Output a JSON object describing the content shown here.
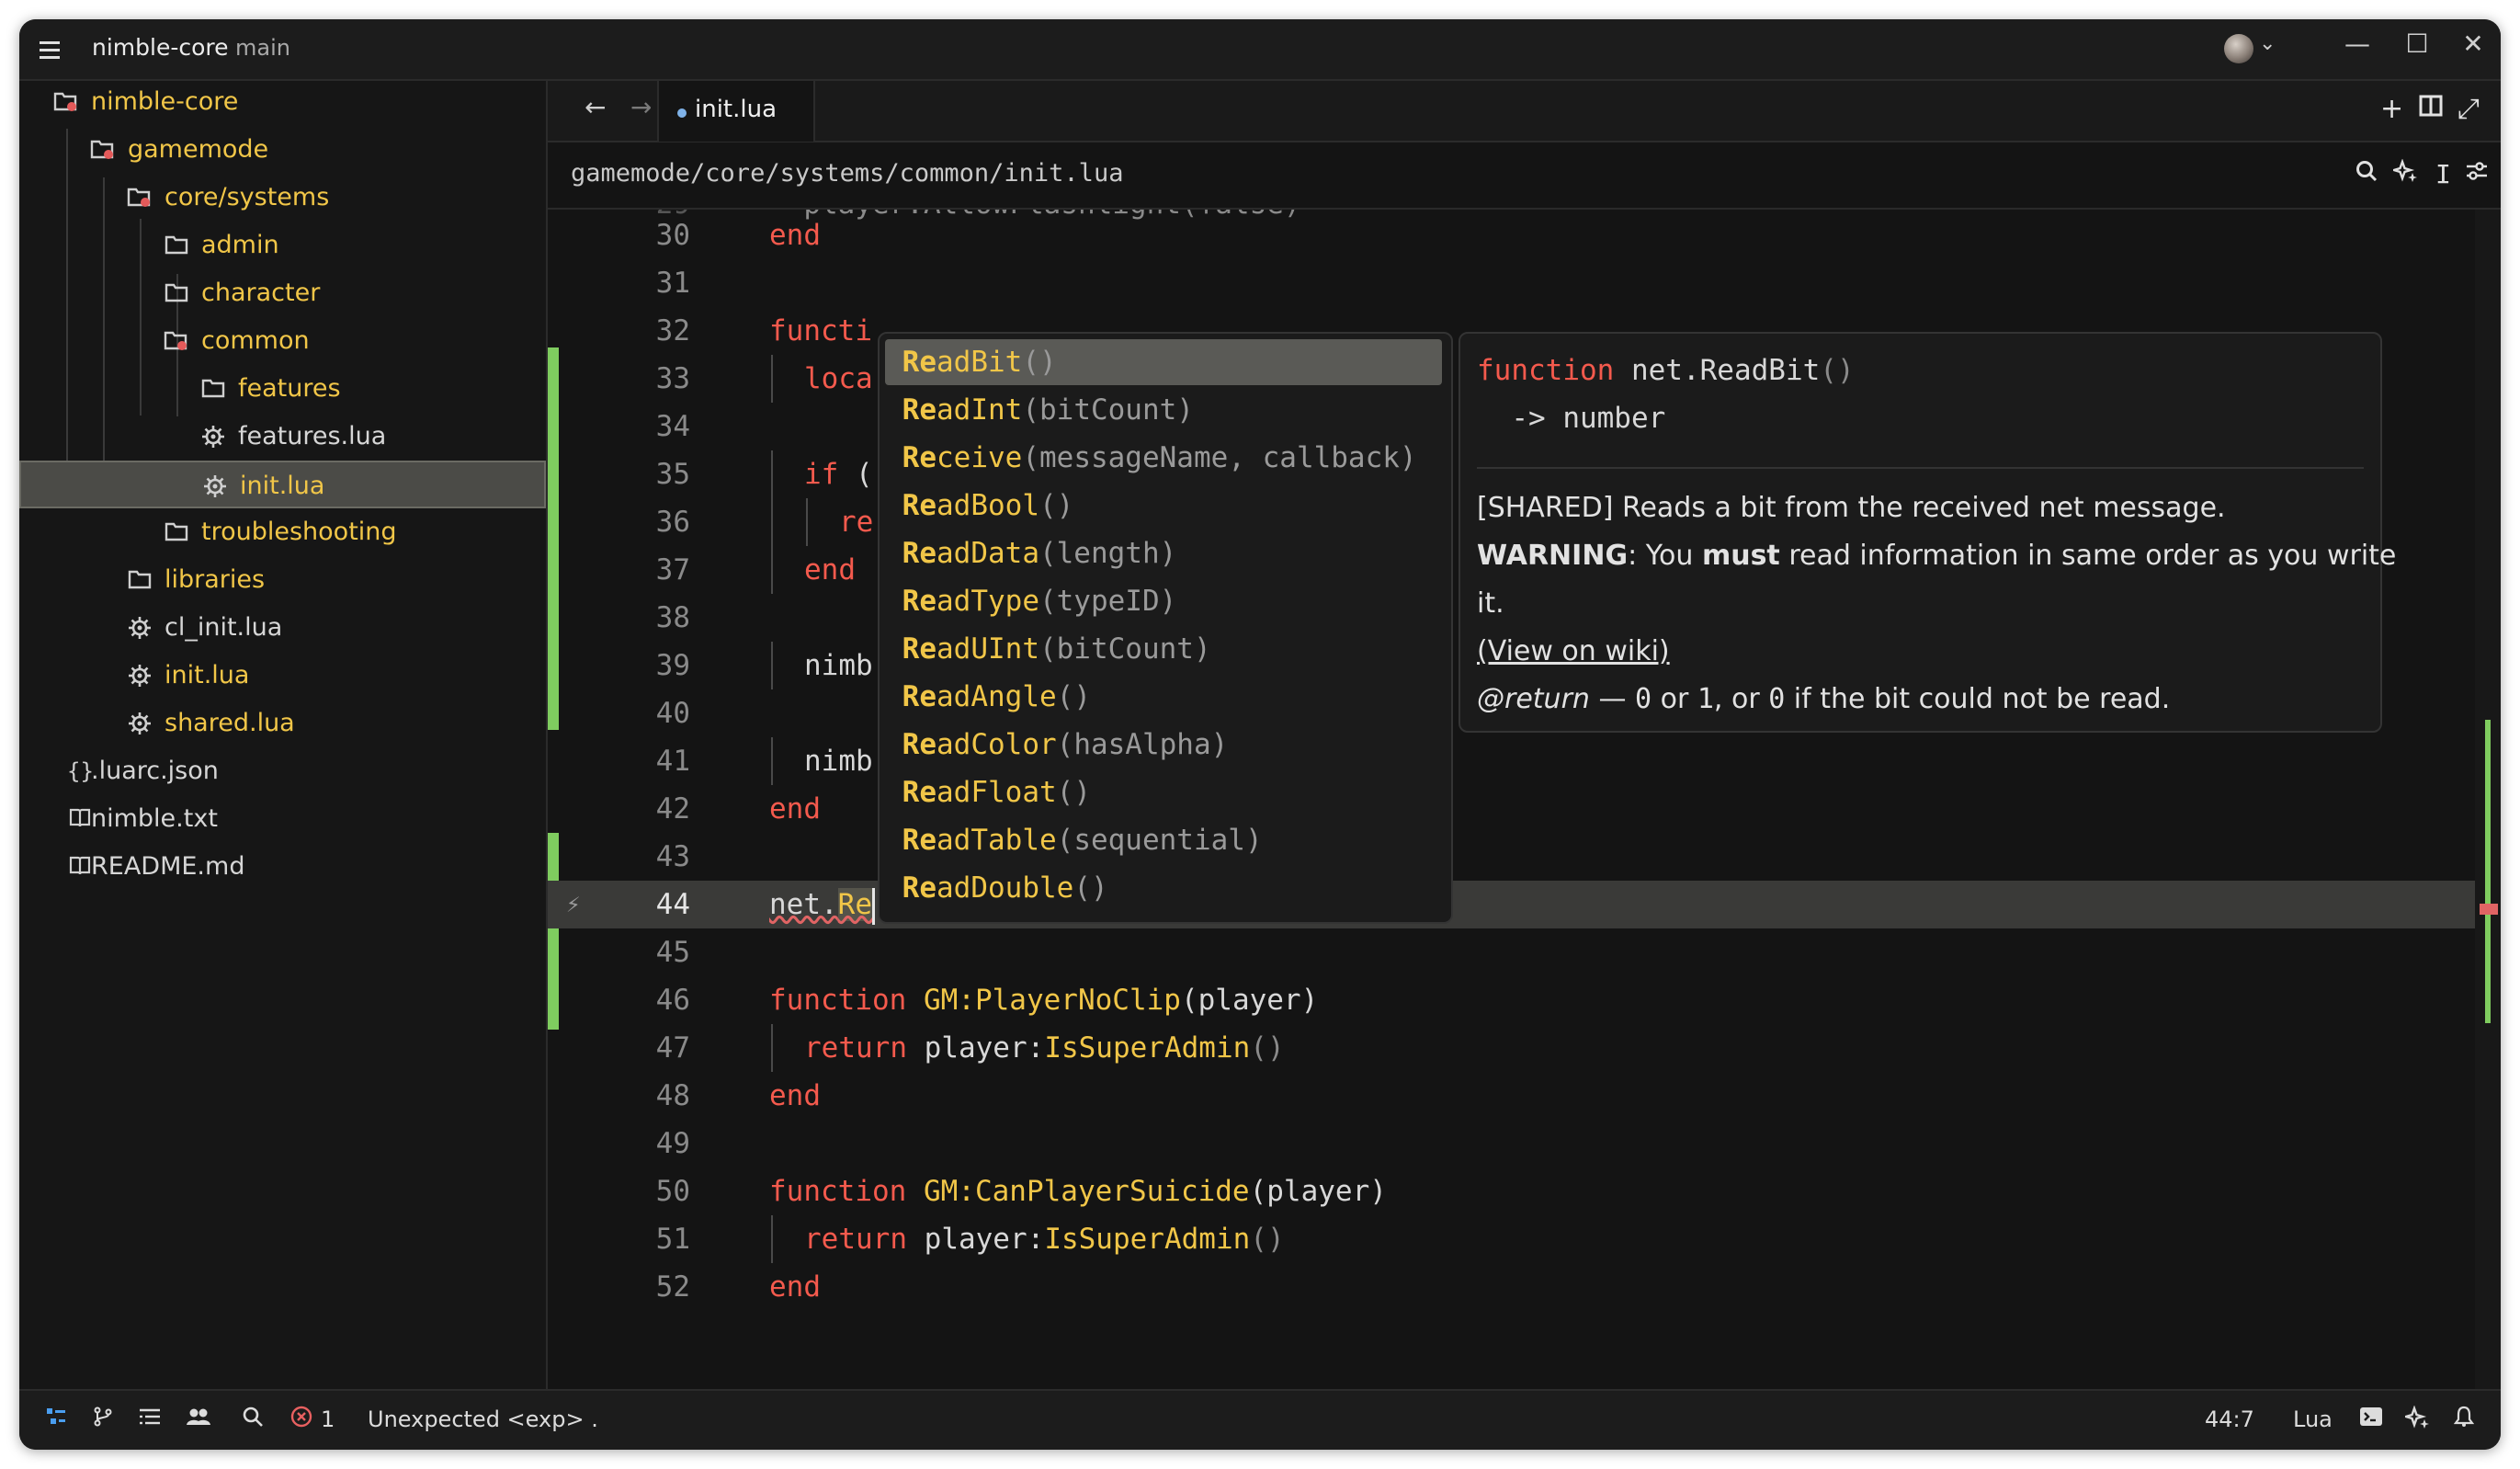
{
  "titlebar": {
    "project": "nimble-core",
    "branch": "main",
    "user_menu_chevron": "⌄"
  },
  "icons": {
    "menu": "hamburger-icon",
    "minimize": "—",
    "maximize": "☐",
    "close": "✕",
    "back": "←",
    "forward": "→",
    "new": "+",
    "split": "split-icon",
    "fullscreen": "⤢",
    "search": "search-icon",
    "assistant": "sparkle-icon",
    "cursor": "I",
    "settings": "sliders-icon",
    "lightning": "⚡"
  },
  "sidebar": {
    "items": [
      {
        "label": "nimble-core",
        "icon": "folder-git-icon",
        "color": "#f1c648"
      },
      {
        "label": "gamemode",
        "icon": "folder-git-icon",
        "color": "#f1c648"
      },
      {
        "label": "core/systems",
        "icon": "folder-git-icon",
        "color": "#f1c648"
      },
      {
        "label": "admin",
        "icon": "folder-icon",
        "color": "#f1c648"
      },
      {
        "label": "character",
        "icon": "folder-icon",
        "color": "#f1c648"
      },
      {
        "label": "common",
        "icon": "folder-git-icon",
        "color": "#f1c648"
      },
      {
        "label": "features",
        "icon": "folder-icon",
        "color": "#f1c648"
      },
      {
        "label": "features.lua",
        "icon": "lua-file-icon",
        "color": "#d6d6d6"
      },
      {
        "label": "init.lua",
        "icon": "lua-file-icon",
        "color": "#f1c648"
      },
      {
        "label": "troubleshooting",
        "icon": "folder-icon",
        "color": "#f1c648"
      },
      {
        "label": "libraries",
        "icon": "folder-icon",
        "color": "#f1c648"
      },
      {
        "label": "cl_init.lua",
        "icon": "lua-file-icon",
        "color": "#d6d6d6"
      },
      {
        "label": "init.lua",
        "icon": "lua-file-icon",
        "color": "#f1c648"
      },
      {
        "label": "shared.lua",
        "icon": "lua-file-icon",
        "color": "#f1c648"
      },
      {
        "label": ".luarc.json",
        "icon": "json-file-icon",
        "color": "#d6d6d6"
      },
      {
        "label": "nimble.txt",
        "icon": "book-icon",
        "color": "#d6d6d6"
      },
      {
        "label": "README.md",
        "icon": "book-icon",
        "color": "#d6d6d6"
      }
    ]
  },
  "tab": {
    "label": "init.lua"
  },
  "breadcrumb": {
    "path": "gamemode/core/systems/common/init.lua"
  },
  "editor": {
    "lines": [
      {
        "n": "30",
        "text": "end"
      },
      {
        "n": "31",
        "text": ""
      },
      {
        "n": "32",
        "text": "functi"
      },
      {
        "n": "33",
        "text": "loca"
      },
      {
        "n": "34",
        "text": ""
      },
      {
        "n": "35",
        "text": "if ("
      },
      {
        "n": "36",
        "text": "re"
      },
      {
        "n": "37",
        "text": "end"
      },
      {
        "n": "38",
        "text": ""
      },
      {
        "n": "39",
        "text": "nimb"
      },
      {
        "n": "40",
        "text": ""
      },
      {
        "n": "41",
        "text": "nimb"
      },
      {
        "n": "42",
        "text": "end"
      },
      {
        "n": "43",
        "text": ""
      },
      {
        "n": "44",
        "text": "net.Re"
      },
      {
        "n": "45",
        "text": ""
      },
      {
        "n": "46",
        "text": "function GM:PlayerNoClip(player)"
      },
      {
        "n": "47",
        "text": "return player:IsSuperAdmin()"
      },
      {
        "n": "48",
        "text": "end"
      },
      {
        "n": "49",
        "text": ""
      },
      {
        "n": "50",
        "text": "function GM:CanPlayerSuicide(player)"
      },
      {
        "n": "51",
        "text": "return player:IsSuperAdmin()"
      },
      {
        "n": "52",
        "text": "end"
      }
    ],
    "partial_top_line": "player:AllowFlashlight(false)"
  },
  "completion": {
    "items": [
      {
        "match": "Re",
        "name": "adBit",
        "args": "()"
      },
      {
        "match": "Re",
        "name": "adInt",
        "args": "(bitCount)"
      },
      {
        "match": "Re",
        "name": "ceive",
        "args": "(messageName, callback)"
      },
      {
        "match": "Re",
        "name": "adBool",
        "args": "()"
      },
      {
        "match": "Re",
        "name": "adData",
        "args": "(length)"
      },
      {
        "match": "Re",
        "name": "adType",
        "args": "(typeID)"
      },
      {
        "match": "Re",
        "name": "adUInt",
        "args": "(bitCount)"
      },
      {
        "match": "Re",
        "name": "adAngle",
        "args": "()"
      },
      {
        "match": "Re",
        "name": "adColor",
        "args": "(hasAlpha)"
      },
      {
        "match": "Re",
        "name": "adFloat",
        "args": "()"
      },
      {
        "match": "Re",
        "name": "adTable",
        "args": "(sequential)"
      },
      {
        "match": "Re",
        "name": "adDouble",
        "args": "()"
      }
    ]
  },
  "docs": {
    "sig_kw": "function",
    "sig_name": " net.ReadBit",
    "sig_args": "()",
    "returns": "  -> number",
    "description": "[SHARED] Reads a bit from the received net message.",
    "warning_label": "WARNING",
    "warning_pre": ": You ",
    "warning_bold": "must",
    "warning_post": " read information in same order as you write",
    "warning_cont": "it.",
    "wiki_link": "(View on wiki)",
    "return_tag": "@return",
    "return_dash": " — ",
    "return_v0": "0",
    "return_or": " or ",
    "return_v1": "1",
    "return_or2": ", or ",
    "return_v2": "0",
    "return_tail": " if the bit could not be read."
  },
  "statusbar": {
    "error_count": "1",
    "message": "Unexpected <exp> .",
    "cursor_position": "44:7",
    "language": "Lua"
  }
}
